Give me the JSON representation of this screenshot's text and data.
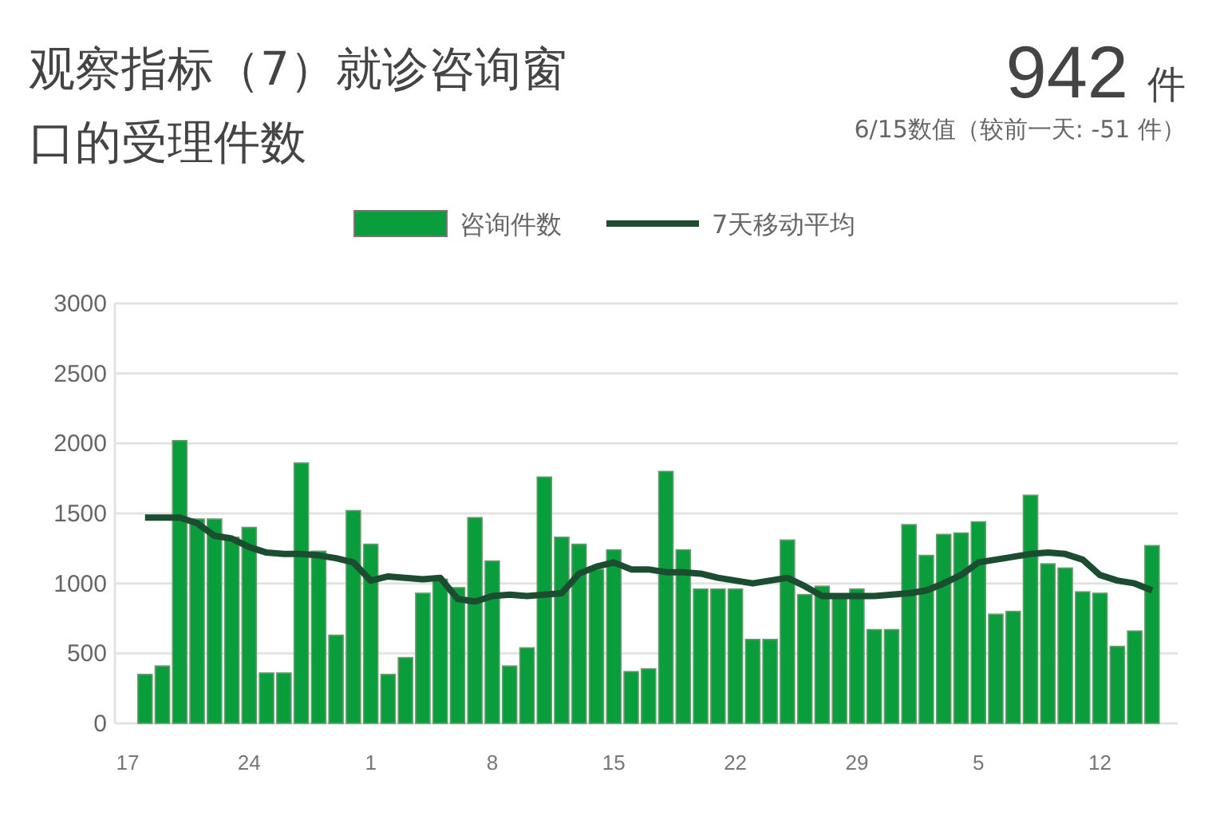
{
  "header": {
    "title": "观察指标（7）就诊咨询窗口的受理件数",
    "value": "942",
    "unit": "件",
    "note": "6/15数值（较前一天: -51 件）"
  },
  "chart_data": {
    "type": "bar",
    "grid": true,
    "legend": true,
    "categories": [
      "17",
      null,
      null,
      null,
      null,
      null,
      null,
      "24",
      null,
      null,
      null,
      null,
      null,
      null,
      "1",
      null,
      null,
      null,
      null,
      null,
      null,
      "8",
      null,
      null,
      null,
      null,
      null,
      null,
      "15",
      null,
      null,
      null,
      null,
      null,
      null,
      "22",
      null,
      null,
      null,
      null,
      null,
      null,
      "29",
      null,
      null,
      null,
      null,
      null,
      null,
      "5",
      null,
      null,
      null,
      null,
      null,
      null,
      "12",
      null,
      null,
      null
    ],
    "ylim": [
      0,
      3000
    ],
    "yticks": [
      0,
      500,
      1000,
      1500,
      2000,
      2500,
      3000
    ],
    "series": [
      {
        "name": "咨询件数",
        "type": "bar",
        "color": "#0a9d3c",
        "values": [
          null,
          350,
          410,
          2020,
          1460,
          1460,
          1330,
          1400,
          360,
          360,
          1860,
          1230,
          630,
          1520,
          1280,
          350,
          470,
          930,
          1030,
          970,
          1470,
          1160,
          410,
          540,
          1760,
          1330,
          1280,
          1100,
          1240,
          370,
          390,
          1800,
          1240,
          960,
          960,
          960,
          600,
          600,
          1310,
          920,
          980,
          920,
          960,
          670,
          670,
          1420,
          1200,
          1350,
          1360,
          1440,
          780,
          800,
          1630,
          1140,
          1110,
          940,
          930,
          550,
          660,
          1270
        ]
      },
      {
        "name": "7天移动平均",
        "type": "line",
        "color": "#1b4d30",
        "values": [
          null,
          1470,
          1470,
          1470,
          1430,
          1340,
          1320,
          1260,
          1220,
          1210,
          1210,
          1200,
          1180,
          1150,
          1020,
          1050,
          1040,
          1030,
          1040,
          890,
          870,
          910,
          920,
          910,
          920,
          930,
          1070,
          1120,
          1150,
          1100,
          1100,
          1080,
          1080,
          1070,
          1040,
          1020,
          1000,
          1020,
          1040,
          980,
          910,
          910,
          910,
          910,
          920,
          930,
          950,
          1000,
          1060,
          1150,
          1170,
          1190,
          1210,
          1220,
          1210,
          1170,
          1060,
          1020,
          1000,
          950
        ]
      }
    ]
  }
}
